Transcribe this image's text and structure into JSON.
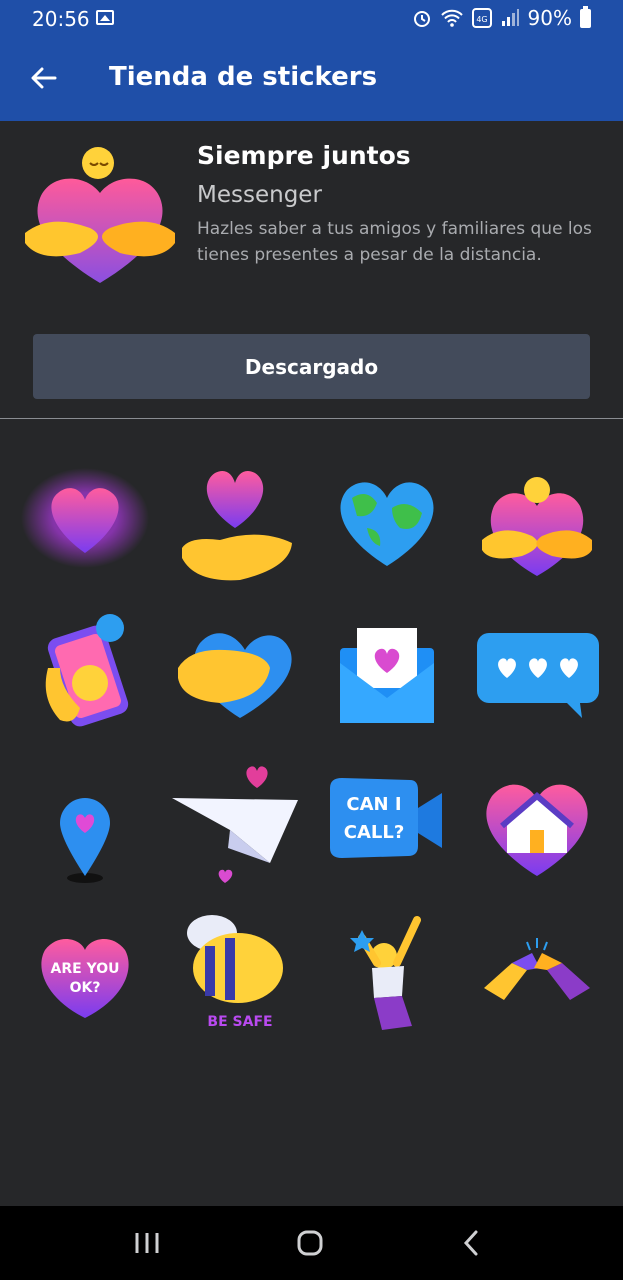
{
  "status_bar": {
    "time": "20:56",
    "battery": "90%"
  },
  "app_bar": {
    "title": "Tienda de stickers"
  },
  "pack": {
    "name": "Siempre juntos",
    "author": "Messenger",
    "description": "Hazles saber a tus amigos y familiares que los tienes presentes a pesar de la distancia.",
    "button_label": "Descargado"
  },
  "stickers": [
    {
      "name": "glowing-heart-sticker"
    },
    {
      "name": "heart-on-hand-sticker"
    },
    {
      "name": "earth-heart-sticker"
    },
    {
      "name": "hugging-heart-sticker"
    },
    {
      "name": "phone-call-smiley-sticker"
    },
    {
      "name": "hand-on-heart-sticker"
    },
    {
      "name": "love-letter-sticker"
    },
    {
      "name": "chat-hearts-sticker"
    },
    {
      "name": "location-heart-sticker"
    },
    {
      "name": "paper-plane-hearts-sticker"
    },
    {
      "name": "can-i-call-sticker",
      "text": "CAN I CALL?"
    },
    {
      "name": "home-heart-sticker"
    },
    {
      "name": "are-you-ok-sticker",
      "text": "ARE YOU OK?"
    },
    {
      "name": "be-safe-bee-sticker",
      "text": "BE SAFE"
    },
    {
      "name": "jumping-person-sticker"
    },
    {
      "name": "elbow-bump-sticker"
    }
  ],
  "colors": {
    "app_bar": "#1f4fa8",
    "background": "#262729",
    "button": "#434b5b"
  }
}
